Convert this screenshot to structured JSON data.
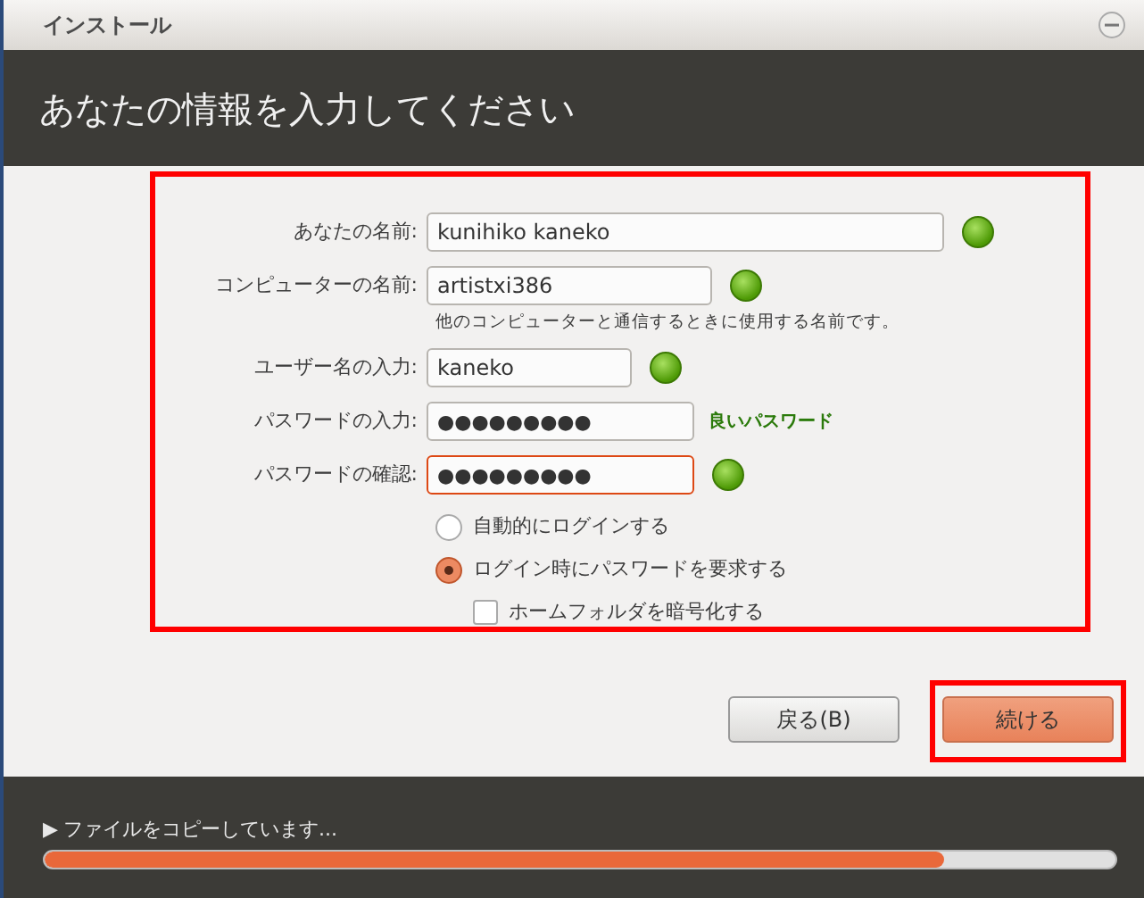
{
  "window": {
    "title": "インストール"
  },
  "header": {
    "title": "あなたの情報を入力してください"
  },
  "form": {
    "highlighted": true,
    "fields": [
      {
        "label": "あなたの名前:",
        "value": "kunihiko kaneko",
        "kind": "text",
        "valid": true,
        "focused": false
      },
      {
        "label": "コンピューターの名前:",
        "value": "artistxi386",
        "kind": "text",
        "valid": true,
        "focused": false,
        "hint": "他のコンピューターと通信するときに使用する名前です。"
      },
      {
        "label": "ユーザー名の入力:",
        "value": "kaneko",
        "kind": "text",
        "valid": true,
        "focused": false
      },
      {
        "label": "パスワードの入力:",
        "value": "●●●●●●●●●",
        "kind": "password",
        "valid": false,
        "focused": false,
        "strength": "良いパスワード"
      },
      {
        "label": "パスワードの確認:",
        "value": "●●●●●●●●●",
        "kind": "password",
        "valid": true,
        "focused": true
      }
    ],
    "login_options": [
      {
        "label": "自動的にログインする",
        "selected": false
      },
      {
        "label": "ログイン時にパスワードを要求する",
        "selected": true
      }
    ],
    "encrypt": {
      "label": "ホームフォルダを暗号化する",
      "checked": false
    }
  },
  "buttons": [
    {
      "label": "戻る(B)",
      "kind": "default",
      "highlighted": false
    },
    {
      "label": "続ける",
      "kind": "primary",
      "highlighted": true
    }
  ],
  "progress": {
    "label": "ファイルをコピーしています...",
    "expander": "▶",
    "level": 0.84
  }
}
